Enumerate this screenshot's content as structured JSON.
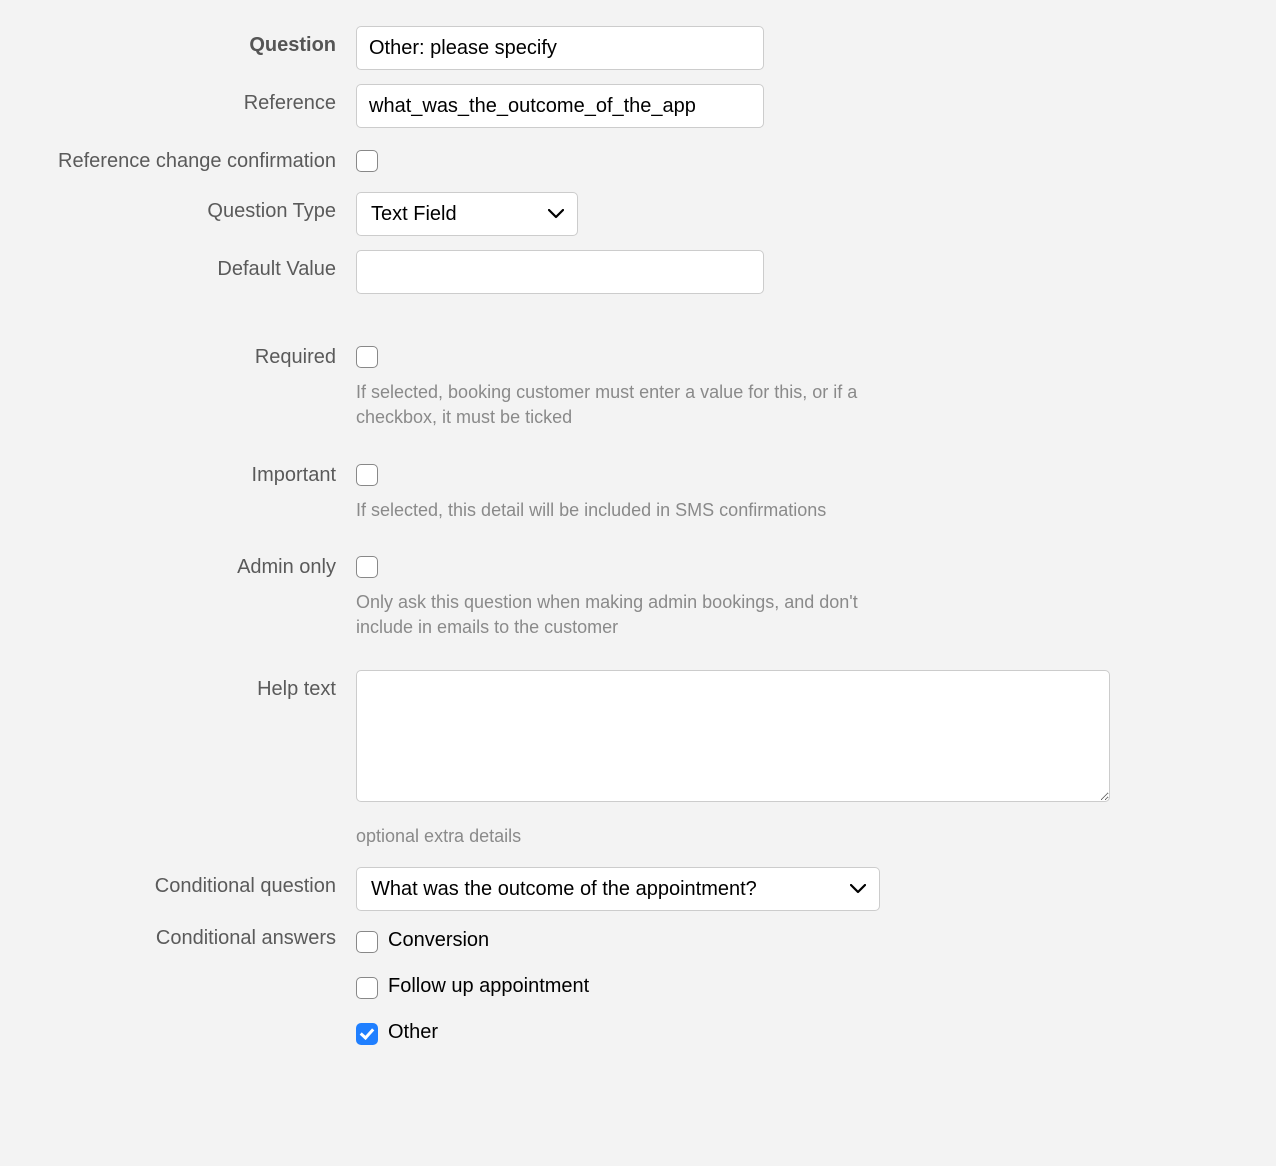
{
  "labels": {
    "question": "Question",
    "reference": "Reference",
    "reference_change_confirmation": "Reference change confirmation",
    "question_type": "Question Type",
    "default_value": "Default Value",
    "required": "Required",
    "important": "Important",
    "admin_only": "Admin only",
    "help_text": "Help text",
    "conditional_question": "Conditional question",
    "conditional_answers": "Conditional answers"
  },
  "values": {
    "question": "Other: please specify",
    "reference": "what_was_the_outcome_of_the_app",
    "reference_change_confirmation": false,
    "question_type": "Text Field",
    "default_value": "",
    "required": false,
    "important": false,
    "admin_only": false,
    "help_text": "",
    "conditional_question": "What was the outcome of the appointment?"
  },
  "help": {
    "required": "If selected, booking customer must enter a value for this, or if a checkbox, it must be ticked",
    "important": "If selected, this detail will be included in SMS confirmations",
    "admin_only": "Only ask this question when making admin bookings, and don't include in emails to the customer",
    "optional_extra_details": "optional extra details"
  },
  "conditional_answers": [
    {
      "label": "Conversion",
      "checked": false
    },
    {
      "label": "Follow up appointment",
      "checked": false
    },
    {
      "label": "Other",
      "checked": true
    }
  ]
}
